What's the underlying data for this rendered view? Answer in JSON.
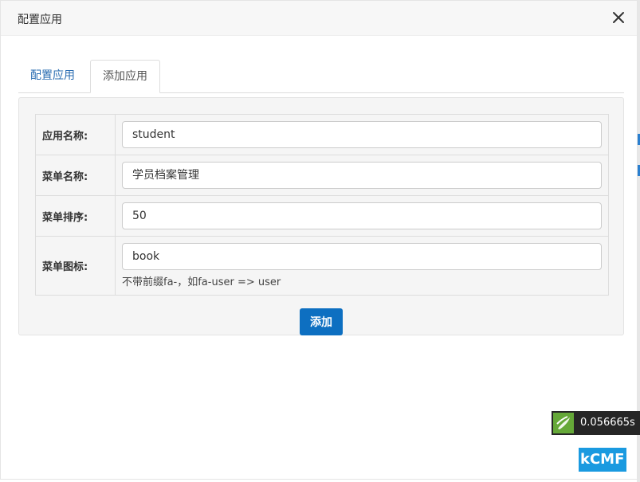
{
  "dialog": {
    "title": "配置应用"
  },
  "tabs": [
    {
      "label": "配置应用",
      "active": false
    },
    {
      "label": "添加应用",
      "active": true
    }
  ],
  "form": {
    "rows": [
      {
        "label": "应用名称:",
        "value": "student"
      },
      {
        "label": "菜单名称:",
        "value": "学员档案管理"
      },
      {
        "label": "菜单排序:",
        "value": "50"
      },
      {
        "label": "菜单图标:",
        "value": "book",
        "help": "不带前缀fa-，如fa-user => user"
      }
    ],
    "submit_label": "添加"
  },
  "debug": {
    "time": "0.056665s"
  },
  "watermark": "kCMF",
  "colors": {
    "primary": "#0d6fc1",
    "tab_link": "#2a6db2",
    "panel_bg": "#f5f5f5",
    "debug_bg": "#262626"
  }
}
